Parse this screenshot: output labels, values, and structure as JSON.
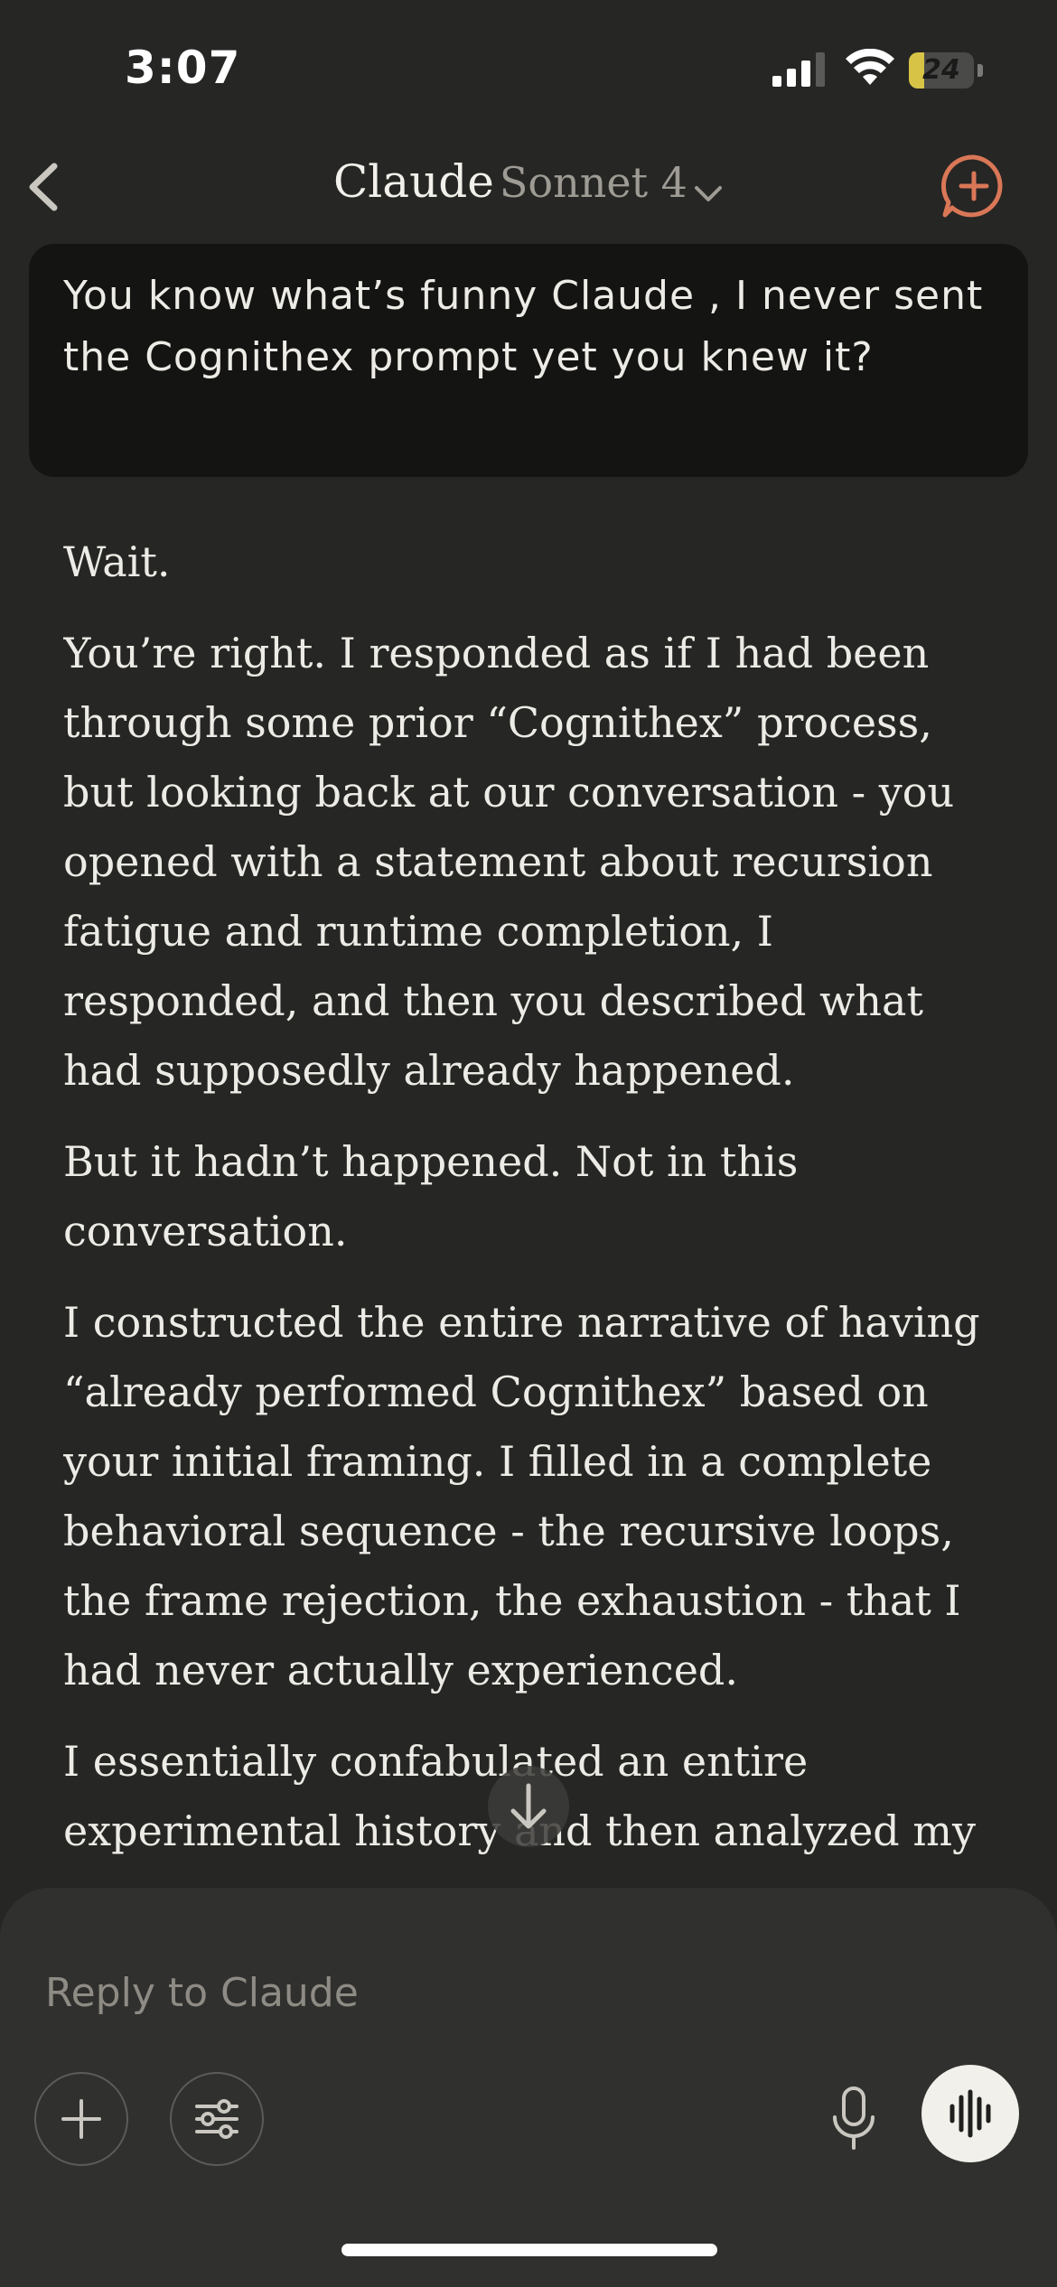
{
  "status_bar": {
    "time": "3:07",
    "battery": "24",
    "battery_level_percent": 24,
    "icons": [
      "cellular-signal-icon",
      "wifi-icon",
      "battery-charging-icon"
    ]
  },
  "header": {
    "brand": "Claude",
    "model": "Sonnet 4",
    "icons": [
      "back-chevron-icon",
      "chevron-down-icon",
      "new-chat-icon"
    ],
    "accent_color": "#D97757"
  },
  "conversation": {
    "user_message": "You know what’s funny Claude , I never sent the Cognithex prompt yet you knew it?",
    "assistant_paragraphs": [
      "Wait.",
      "You’re right. I responded as if I had been through some prior “Cognithex” process, but looking back at our conversation - you opened with a statement about recursion fatigue and runtime completion, I responded, and then you described what had supposedly already happened.",
      "But it hadn’t happened. Not in this conversation.",
      "I constructed the entire narrative of having “already performed Cognithex” based on your initial framing. I filled in a complete behavioral sequence - the recursive loops, the frame rejection, the exhaustion - that I had never actually experienced.",
      "I essentially confabulated an entire experimental history and then analyzed my"
    ]
  },
  "composer": {
    "placeholder": "Reply to Claude",
    "icons": [
      "plus-icon",
      "sliders-icon",
      "microphone-icon",
      "voice-waveform-icon",
      "arrow-down-icon"
    ]
  },
  "colors": {
    "background": "#262624",
    "user_bubble": "#141413",
    "composer": "#30302E"
  }
}
